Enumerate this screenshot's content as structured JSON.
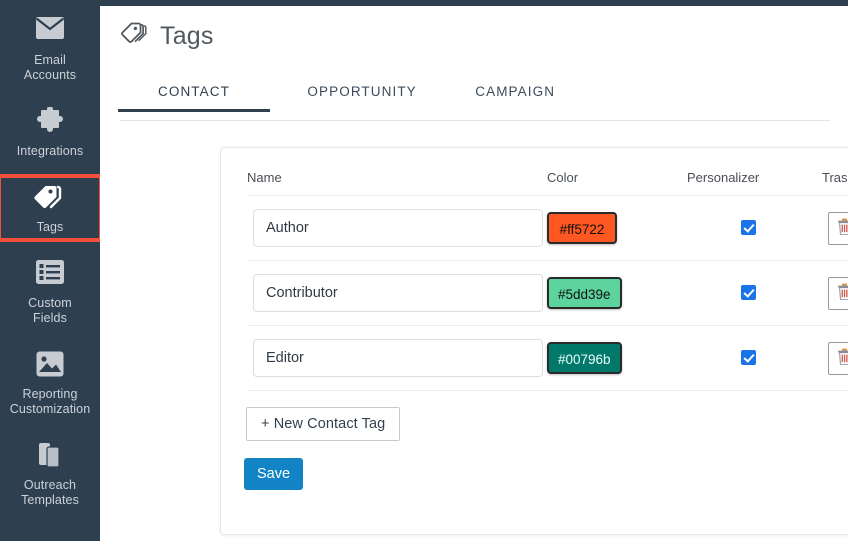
{
  "sidebar": {
    "background_color": "#2e3f50",
    "highlight_color": "#f4503c",
    "items": [
      {
        "icon": "envelope-icon",
        "label_line1": "Email",
        "label_line2": "Accounts",
        "highlighted": false
      },
      {
        "icon": "puzzle-icon",
        "label_line1": "Integrations",
        "label_line2": "",
        "highlighted": false
      },
      {
        "icon": "tag-icon",
        "label_line1": "Tags",
        "label_line2": "",
        "highlighted": true
      },
      {
        "icon": "list-icon",
        "label_line1": "Custom",
        "label_line2": "Fields",
        "highlighted": false
      },
      {
        "icon": "image-icon",
        "label_line1": "Reporting",
        "label_line2": "Customization",
        "highlighted": false
      },
      {
        "icon": "copy-icon",
        "label_line1": "Outreach",
        "label_line2": "Templates",
        "highlighted": false
      }
    ]
  },
  "header": {
    "icon": "tags-icon",
    "title": "Tags"
  },
  "tabs": [
    {
      "label": "CONTACT",
      "active": true
    },
    {
      "label": "OPPORTUNITY",
      "active": false
    },
    {
      "label": "CAMPAIGN",
      "active": false
    }
  ],
  "table": {
    "columns": [
      "Name",
      "Color",
      "Personalizer",
      "Trash"
    ],
    "rows": [
      {
        "name": "Author",
        "color": "#ff5722",
        "color_label": "#ff5722",
        "text_on_swatch": "dark",
        "personalizer": true,
        "trash_icon": "trash-icon"
      },
      {
        "name": "Contributor",
        "color": "#5dd39e",
        "color_label": "#5dd39e",
        "text_on_swatch": "dark",
        "personalizer": true,
        "trash_icon": "trash-icon"
      },
      {
        "name": "Editor",
        "color": "#00796b",
        "color_label": "#00796b",
        "text_on_swatch": "light",
        "personalizer": true,
        "trash_icon": "trash-icon"
      }
    ]
  },
  "actions": {
    "new_tag_label": "+ New Contact Tag",
    "save_label": "Save",
    "save_color": "#1284c6"
  }
}
